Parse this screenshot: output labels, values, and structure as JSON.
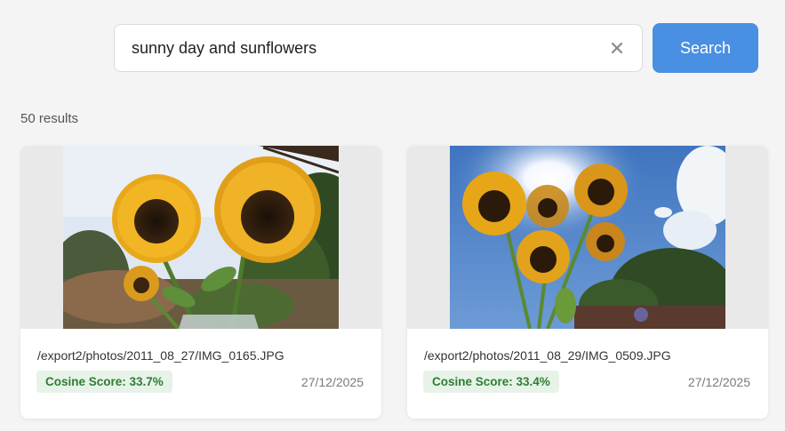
{
  "search": {
    "query": "sunny day and sunflowers",
    "clear_icon": "close-icon",
    "button_label": "Search",
    "accent_color": "#4a90e2"
  },
  "results": {
    "count_label": "50 results",
    "items": [
      {
        "path": "/export2/photos/2011_08_27/IMG_0165.JPG",
        "score_label": "Cosine Score: 33.7%",
        "date": "27/12/2025",
        "image": "sunflowers-in-vase-photo"
      },
      {
        "path": "/export2/photos/2011_08_29/IMG_0509.JPG",
        "score_label": "Cosine Score: 33.4%",
        "date": "27/12/2025",
        "image": "sunflowers-against-sun-photo"
      }
    ]
  }
}
